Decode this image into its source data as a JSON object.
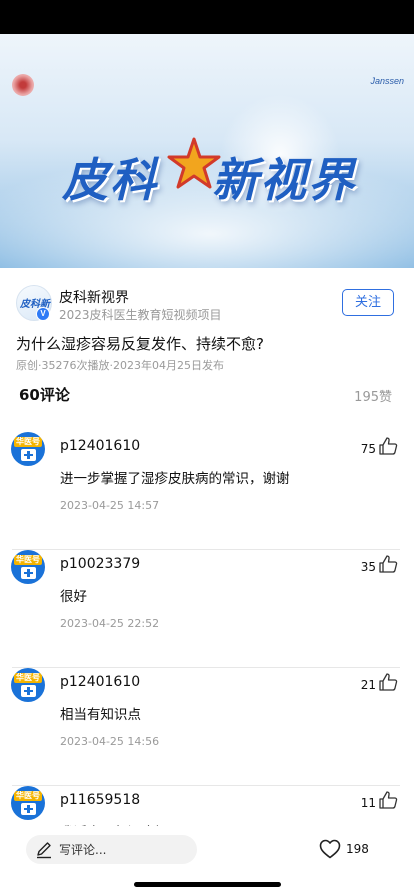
{
  "video": {
    "brand_word_1": "皮科",
    "brand_word_2": "新视界",
    "sponsor_logo_text": "Janssen"
  },
  "author": {
    "name": "皮科新视界",
    "description": "2023皮科医生教育短视频项目",
    "avatar_text": "皮科新",
    "verified_badge": "V",
    "follow_label": "关注"
  },
  "post": {
    "title": "为什么湿疹容易反复发作、持续不愈?",
    "meta": "原创·35276次播放·2023年04月25日发布"
  },
  "comments_header": {
    "count_label": "60评论",
    "likes_label": "195赞"
  },
  "comments": [
    {
      "user": "p12401610",
      "likes": "75",
      "text": "进一步掌握了湿疹皮肤病的常识，谢谢",
      "time": "2023-04-25 14:57",
      "avatar_tag": "华医号"
    },
    {
      "user": "p10023379",
      "likes": "35",
      "text": "很好",
      "time": "2023-04-25 22:52",
      "avatar_tag": "华医号"
    },
    {
      "user": "p12401610",
      "likes": "21",
      "text": "相当有知识点",
      "time": "2023-04-25 14:56",
      "avatar_tag": "华医号"
    },
    {
      "user": "p11659518",
      "likes": "11",
      "text": "我近十五年湿疹好了",
      "time": "",
      "avatar_tag": "华医号"
    }
  ],
  "bottom_bar": {
    "write_placeholder": "写评论...",
    "heart_count": "198"
  },
  "colors": {
    "accent": "#2f6fe0",
    "brand_blue": "#1f5fc2",
    "avatar_blue": "#1a72d8"
  }
}
